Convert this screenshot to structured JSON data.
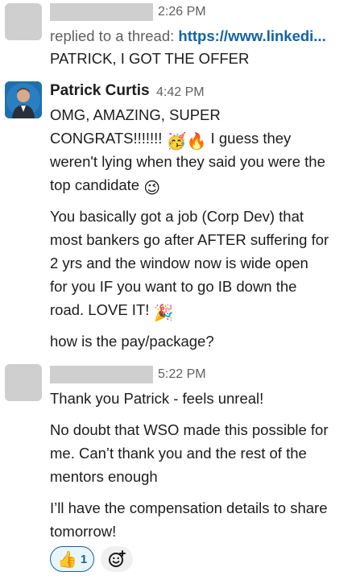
{
  "message1": {
    "time": "2:26 PM",
    "thread_prefix": "replied to a thread:",
    "thread_link": "https://www.linkedi...",
    "text": "PATRICK, I GOT THE OFFER"
  },
  "message2": {
    "sender": "Patrick Curtis",
    "time": "4:42 PM",
    "p1": {
      "line1": "OMG, AMAZING, SUPER",
      "line2_a": "CONGRATS!!!!!!!",
      "line2_b": "I guess they",
      "line3": "weren't lying when they said you were the",
      "line4": "top candidate"
    },
    "p2": {
      "line1": "You basically got a job (Corp Dev) that",
      "line2": "most bankers go after AFTER suffering for",
      "line3": "2 yrs and the window now is wide open",
      "line4": "for you IF you want to go IB down the",
      "line5": "road.  LOVE IT!"
    },
    "p3": "how is the pay/package?"
  },
  "message3": {
    "time": "5:22 PM",
    "p1": "Thank you Patrick - feels unreal!",
    "p2": {
      "line1": "No doubt that WSO made this possible for",
      "line2": "me. Can’t thank you and the rest of the",
      "line3": "mentors enough"
    },
    "p3": {
      "line1": "I’ll have the compensation details to share",
      "line2": "tomorrow!"
    },
    "reaction": {
      "emoji": "thumbs-up",
      "count": "1"
    }
  },
  "colors": {
    "link": "#1264a3",
    "muted": "#616061",
    "redacted": "#cfcfcf",
    "reaction_bg": "#e8f5fa"
  }
}
